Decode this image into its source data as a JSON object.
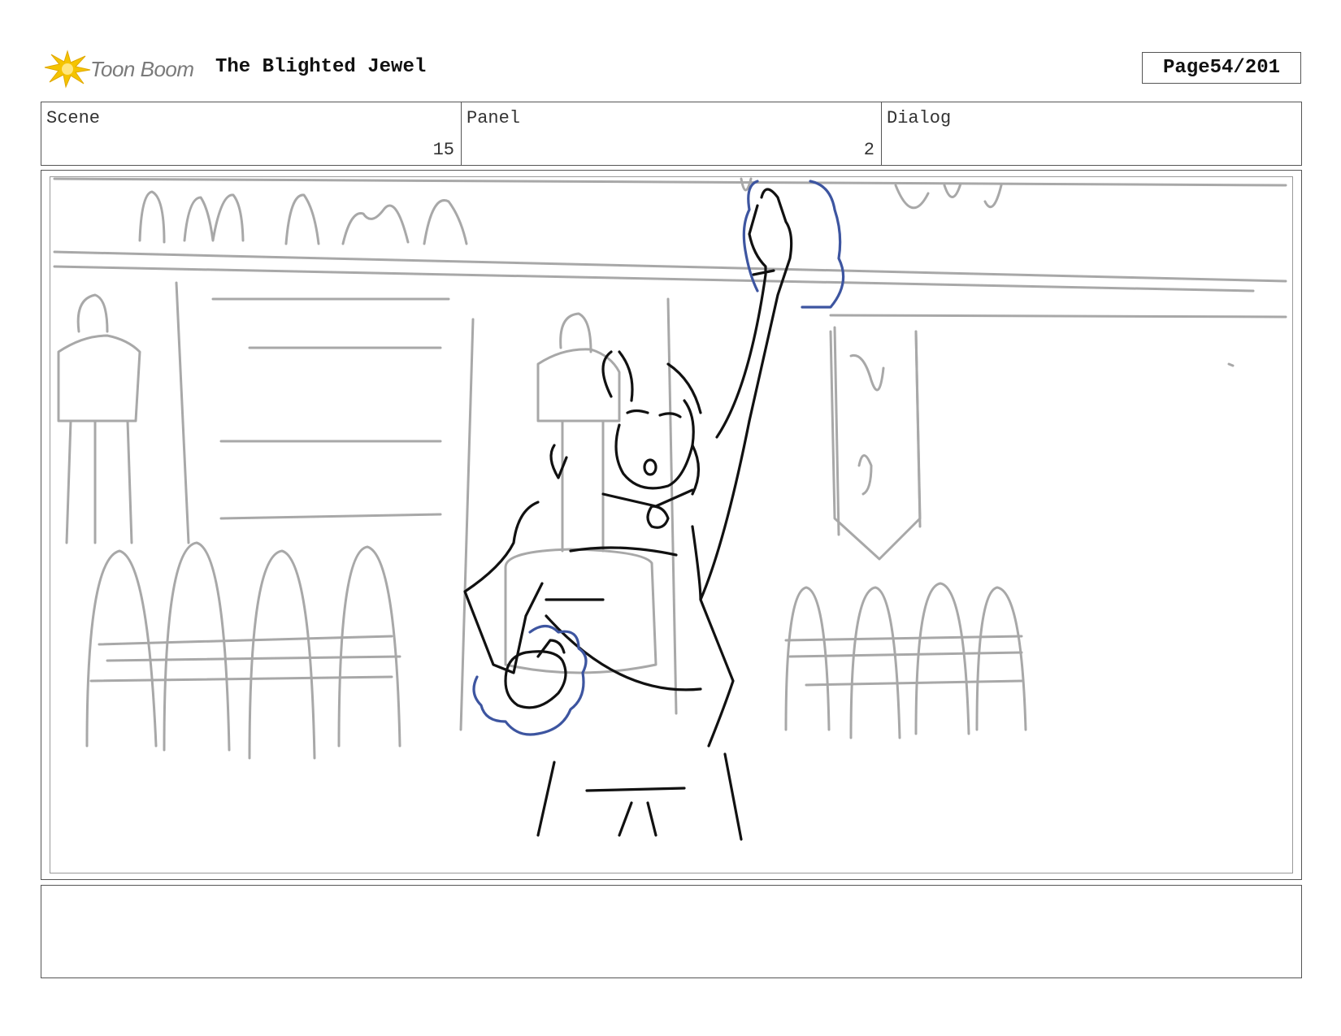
{
  "header": {
    "logo_text": "Toon Boom",
    "title": "The Blighted Jewel",
    "page_label": "Page",
    "page_value": "54/201"
  },
  "info": {
    "scene_label": "Scene",
    "scene_value": "15",
    "panel_label": "Panel",
    "panel_value": "2",
    "dialog_label": "Dialog",
    "dialog_value": ""
  },
  "notes": {
    "text": ""
  },
  "colors": {
    "logo_accent": "#f5c400",
    "sketch_grey": "#a8a8a8",
    "sketch_black": "#111111",
    "sketch_blue": "#3d55a0"
  }
}
